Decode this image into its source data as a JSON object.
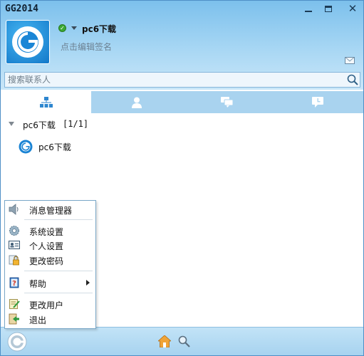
{
  "window": {
    "title": "GG2014",
    "accent_color": "#7cc0ec",
    "controls": [
      "minimize-icon",
      "maximize-icon",
      "close-icon"
    ],
    "close_label": "✕"
  },
  "profile": {
    "nickname": "pc6下载",
    "status": "online",
    "status_icon": "check-icon",
    "signature": "点击编辑签名"
  },
  "search": {
    "placeholder": "搜索联系人",
    "value": ""
  },
  "tabs": [
    {
      "icon": "org-chart-icon",
      "active": true
    },
    {
      "icon": "contact-icon",
      "active": false
    },
    {
      "icon": "chat-bubbles-icon",
      "active": false
    },
    {
      "icon": "recent-icon",
      "active": false
    }
  ],
  "contacts": {
    "group": {
      "name": "pc6下载",
      "count": "[1/1]"
    },
    "items": [
      {
        "name": "pc6下载",
        "icon": "gg-logo-icon"
      }
    ]
  },
  "menu": {
    "items": [
      {
        "label": "消息管理器",
        "icon": "speaker-icon"
      },
      {
        "label": "系统设置",
        "icon": "gear-icon"
      },
      {
        "label": "个人设置",
        "icon": "id-card-icon"
      },
      {
        "label": "更改密码",
        "icon": "lock-icon"
      },
      {
        "label": "帮助",
        "icon": "help-book-icon",
        "has_submenu": true
      },
      {
        "label": "更改用户",
        "icon": "notepad-icon"
      },
      {
        "label": "退出",
        "icon": "exit-icon"
      }
    ]
  },
  "bottom_bar": {
    "icons": [
      "gg-logo-icon",
      "home-icon",
      "magnifier-icon"
    ]
  }
}
